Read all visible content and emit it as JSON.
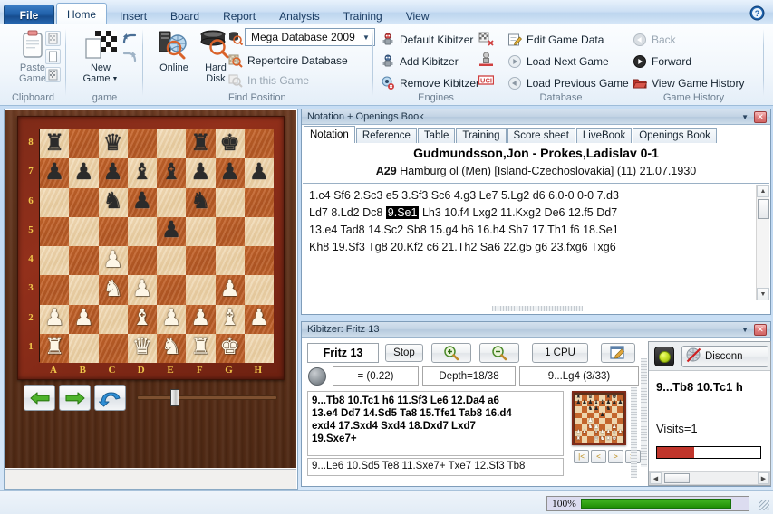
{
  "titlebar": {
    "file_tab": "File",
    "tabs": [
      "Home",
      "Insert",
      "Board",
      "Report",
      "Analysis",
      "Training",
      "View"
    ],
    "active_tab": "Home",
    "help_icon": "help-icon"
  },
  "ribbon": {
    "clipboard": {
      "group_label": "Clipboard",
      "paste_game": "Paste\nGame",
      "paste_line1": "Paste",
      "paste_line2": "Game",
      "icon_copy_game": "copy-game-icon",
      "icon_blank_page": "blank-page-icon",
      "icon_copy_position": "copy-position-icon"
    },
    "game": {
      "group_label": "game",
      "new_game_line1": "New",
      "new_game_line2": "Game",
      "icon_new_game": "new-game-icon",
      "icon_undo": "undo-icon",
      "icon_redo": "redo-icon"
    },
    "find_position": {
      "group_label": "Find Position",
      "online_line1": "Online",
      "hard_line1": "Hard",
      "hard_line2": "Disk",
      "database_value": "Mega Database 2009",
      "repertoire": "Repertoire Database",
      "in_this_game": "In this Game",
      "icon_online": "online-search-icon",
      "icon_harddisk": "hard-disk-search-icon",
      "icon_database_search": "database-search-icon",
      "icon_repertoire": "repertoire-search-icon",
      "icon_in_game": "in-game-search-icon"
    },
    "engines": {
      "group_label": "Engines",
      "default_kibitzer": "Default Kibitzer",
      "add_kibitzer": "Add Kibitzer",
      "remove_kibitzer": "Remove Kibitzer",
      "icon_default_kibitzer": "robot-icon",
      "icon_add_kibitzer": "robot-add-icon",
      "icon_remove_kibitzer": "robot-remove-icon",
      "icon_engine_compare": "engine-compare-icon",
      "icon_engine_tournament": "engine-tournament-icon",
      "icon_uci": "uci-icon"
    },
    "database": {
      "group_label": "Database",
      "edit_game_data": "Edit Game Data",
      "load_next_game": "Load Next Game",
      "load_previous_game": "Load Previous Game",
      "icon_edit": "edit-pencil-icon",
      "icon_next": "play-next-icon",
      "icon_previous": "play-previous-icon"
    },
    "game_history": {
      "group_label": "Game History",
      "back": "Back",
      "forward": "Forward",
      "view_game_history": "View Game History",
      "icon_back": "back-arrow-icon",
      "icon_forward": "forward-arrow-icon",
      "icon_history": "folder-history-icon"
    }
  },
  "board": {
    "rank_labels": [
      "8",
      "7",
      "6",
      "5",
      "4",
      "3",
      "2",
      "1"
    ],
    "file_labels": [
      "A",
      "B",
      "C",
      "D",
      "E",
      "F",
      "G",
      "H"
    ],
    "position": [
      [
        "br",
        "",
        "bq",
        "",
        "",
        "br",
        "bk",
        ""
      ],
      [
        "bp",
        "bp",
        "bp",
        "bb",
        "bb",
        "bp",
        "bp",
        "bp"
      ],
      [
        "",
        "",
        "bn",
        "bp",
        "",
        "bn",
        "",
        ""
      ],
      [
        "",
        "",
        "",
        "",
        "bp",
        "",
        "",
        ""
      ],
      [
        "",
        "",
        "wp",
        "",
        "",
        "",
        "",
        ""
      ],
      [
        "",
        "",
        "wn",
        "wp",
        "",
        "",
        "wp",
        ""
      ],
      [
        "wp",
        "wp",
        "",
        "wb",
        "wp",
        "wp",
        "wb",
        "wp"
      ],
      [
        "wr",
        "",
        "",
        "wq",
        "wn",
        "wr",
        "wk",
        ""
      ]
    ],
    "controls": {
      "back_button": "back-arrow-button",
      "forward_button": "forward-arrow-button",
      "flip_button": "undo-move-button",
      "slider": "move-slider",
      "slider_value": 50
    }
  },
  "notation_panel": {
    "caption": "Notation + Openings Book",
    "dropdown_icon": "chevron-down-icon",
    "close_icon": "close-icon",
    "tabs": [
      "Notation",
      "Reference",
      "Table",
      "Training",
      "Score sheet",
      "LiveBook",
      "Openings Book"
    ],
    "active_tab": "Notation",
    "game_title": "Gudmundsson,Jon - Prokes,Ladislav  0-1",
    "eco": "A29",
    "game_info": "Hamburg ol (Men) [Island-Czechoslovakia] (11) 21.07.1930",
    "moves_lines": [
      "1.c4 Sf6 2.Sc3 e5 3.Sf3 Sc6 4.g3 Le7 5.Lg2 d6 6.0-0 0-0 7.d3",
      "Ld7 8.Ld2 Dc8 |9.Se1| Lh3 10.f4 Lxg2 11.Kxg2 De6 12.f5 Dd7",
      "13.e4 Tad8 14.Sc2 Sb8 15.g4 h6 16.h4 Sh7 17.Th1 f6 18.Se1",
      "Kh8 19.Sf3 Tg8 20.Kf2 c6 21.Th2 Sa6 22.g5 g6 23.fxg6 Txg6"
    ],
    "highlighted_move": "9.Se1"
  },
  "kibitzer_panel": {
    "caption": "Kibitzer: Fritz 13",
    "dropdown_icon": "chevron-down-icon",
    "close_icon": "close-icon",
    "engine_name": "Fritz 13",
    "stop_button": "Stop",
    "zoom_in_icon": "zoom-in-icon",
    "zoom_out_icon": "zoom-out-icon",
    "cpu_button": "1 CPU",
    "notes_icon": "notepad-icon",
    "lock_icon": "lock-icon",
    "eval_ball": "eval-indicator",
    "evaluation": "=  (0.22)",
    "depth": "Depth=18/38",
    "current_move": "9...Lg4 (3/33)",
    "analysis_lines": [
      "9...Tb8 10.Tc1 h6 11.Sf3 Le6 12.Da4 a6",
      "13.e4 Dd7 14.Sd5 Ta8 15.Tfe1 Tab8 16.d4",
      "exd4 17.Sxd4 Sxd4 18.Dxd7 Lxd7",
      "19.Sxe7+"
    ],
    "secondary_line": "9...Le6 10.Sd5 Te8 11.Sxe7+ Txe7 12.Sf3 Tb8",
    "mini_board": [
      [
        "br",
        "",
        "bq",
        "",
        "",
        "br",
        "bk",
        ""
      ],
      [
        "bp",
        "bp",
        "bp",
        "bb",
        "bb",
        "bp",
        "bp",
        "bp"
      ],
      [
        "",
        "",
        "bn",
        "bp",
        "",
        "bn",
        "",
        ""
      ],
      [
        "",
        "",
        "",
        "",
        "bp",
        "",
        "",
        ""
      ],
      [
        "",
        "",
        "wp",
        "",
        "",
        "",
        "",
        ""
      ],
      [
        "",
        "",
        "wn",
        "wp",
        "",
        "",
        "wp",
        ""
      ],
      [
        "wp",
        "wp",
        "",
        "wb",
        "wp",
        "wp",
        "wb",
        "wp"
      ],
      [
        "wr",
        "",
        "",
        "wq",
        "wn",
        "wr",
        "wk",
        ""
      ]
    ],
    "mini_nav": [
      "|<",
      "<",
      ">",
      ">|"
    ]
  },
  "right_panel": {
    "led": "status-led-green",
    "disconnect_label": "Disconn",
    "disconnect_icon": "disconnect-globe-icon",
    "headline": "9...Tb8 10.Tc1 h",
    "visits": "Visits=1",
    "bar_color": "#c0352b",
    "bar_percent": 36
  },
  "statusbar": {
    "progress_label": "100%",
    "progress_percent": 100,
    "progress_color": "#2f9e12"
  }
}
